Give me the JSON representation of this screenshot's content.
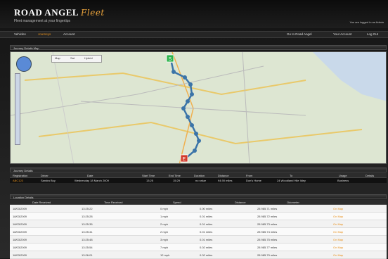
{
  "app": {
    "brand": "ROAD ANGEL",
    "brand_sub": "Fleet",
    "tagline": "Fleet management at your fingertips",
    "user_text": "You are logged in as Admin"
  },
  "nav": {
    "items": [
      "Vehicles",
      "Journeys",
      "Account"
    ],
    "right_items": [
      "Go to Road Angel",
      "Your Account",
      "Log Out"
    ]
  },
  "map_panel": {
    "title": "Journey Details Map",
    "toolbar": [
      "Map",
      "Sat",
      "Hybrid"
    ],
    "start_marker": "S",
    "end_marker": "E",
    "compass_icon": "pan-compass-icon",
    "colors": {
      "route": "#3b74a8",
      "start": "#2bb34a",
      "end": "#d23a2a"
    }
  },
  "journey_details": {
    "title": "Journey Details",
    "headers": [
      "Registration",
      "Driver",
      "Date",
      "Start Time",
      "End Time",
      "Duration",
      "Distance",
      "From",
      "To",
      "Usage",
      "Details"
    ],
    "row": [
      "ABC123",
      "Sandra Buy",
      "Wednesday 18 March 2009",
      "13:25",
      "15:29",
      "no value",
      "94.90 miles",
      "Don's Home",
      "24 Woodland Hile Ikley",
      "Business",
      ""
    ]
  },
  "location_details": {
    "title": "Location Details",
    "headers": [
      "Date Received",
      "Time Received",
      "Speed",
      "Distance",
      "Odometer",
      ""
    ],
    "rows": [
      [
        "18/03/2009",
        "13:25:22",
        "0 mph",
        "0.00 miles",
        "28 985.71 miles",
        "On Map"
      ],
      [
        "18/03/2009",
        "13:25:28",
        "1 mph",
        "0.01 miles",
        "28 985.72 miles",
        "On Map"
      ],
      [
        "18/03/2009",
        "13:25:35",
        "2 mph",
        "0.01 miles",
        "28 985.73 miles",
        "On Map"
      ],
      [
        "18/03/2009",
        "13:25:41",
        "2 mph",
        "0.01 miles",
        "28 985.74 miles",
        "On Map"
      ],
      [
        "18/03/2009",
        "13:25:48",
        "3 mph",
        "0.01 miles",
        "28 985.75 miles",
        "On Map"
      ],
      [
        "18/03/2009",
        "13:25:54",
        "7 mph",
        "0.02 miles",
        "28 985.77 miles",
        "On Map"
      ],
      [
        "18/03/2009",
        "13:26:01",
        "12 mph",
        "0.02 miles",
        "28 985.79 miles",
        "On Map"
      ]
    ]
  }
}
